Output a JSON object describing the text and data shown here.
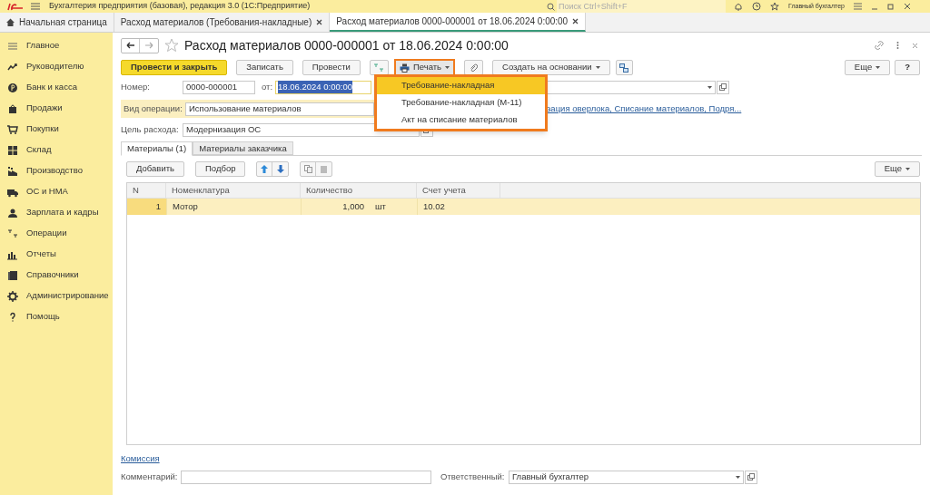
{
  "app_bar": {
    "title": "Бухгалтерия предприятия (базовая), редакция 3.0  (1С:Предприятие)",
    "search_placeholder": "Поиск Ctrl+Shift+F",
    "user": "Главный бухгалтер"
  },
  "tabs": [
    {
      "label": "Начальная страница",
      "kind": "home",
      "selected": false
    },
    {
      "label": "Расход материалов (Требования-накладные)",
      "kind": "doc",
      "selected": false
    },
    {
      "label": "Расход материалов 0000-000001 от 18.06.2024 0:00:00",
      "kind": "doc",
      "selected": true
    }
  ],
  "sidebar": {
    "items": [
      {
        "label": "Главное"
      },
      {
        "label": "Руководителю"
      },
      {
        "label": "Банк и касса"
      },
      {
        "label": "Продажи"
      },
      {
        "label": "Покупки"
      },
      {
        "label": "Склад"
      },
      {
        "label": "Производство"
      },
      {
        "label": "ОС и НМА"
      },
      {
        "label": "Зарплата и кадры"
      },
      {
        "label": "Операции"
      },
      {
        "label": "Отчеты"
      },
      {
        "label": "Справочники"
      },
      {
        "label": "Администрирование"
      },
      {
        "label": "Помощь"
      }
    ]
  },
  "form": {
    "title": "Расход материалов 0000-000001 от 18.06.2024 0:00:00",
    "toolbar": {
      "primary": "Провести и закрыть",
      "save": "Записать",
      "post": "Провести",
      "print": "Печать",
      "create_based": "Создать на основании",
      "more": "Еще",
      "help": "?"
    },
    "print_menu": [
      {
        "label": "Требование-накладная",
        "selected": true
      },
      {
        "label": "Требование-накладная (М-11)",
        "selected": false
      },
      {
        "label": "Акт на списание материалов",
        "selected": false
      }
    ],
    "number_label": "Номер:",
    "number": "0000-000001",
    "date_label": "от:",
    "date": "18.06.2024  0:00:00",
    "operation_label": "Вид операции:",
    "operation": "Использование материалов",
    "operation_link": "зация оверлока, Списание материалов, Подря...",
    "purpose_label": "Цель расхода:",
    "purpose": "Модернизация ОС",
    "sub_tabs": [
      {
        "label": "Материалы (1)",
        "selected": true
      },
      {
        "label": "Материалы заказчика",
        "selected": false
      }
    ],
    "table_toolbar": {
      "add": "Добавить",
      "pick": "Подбор",
      "more": "Еще"
    },
    "table": {
      "columns": [
        "N",
        "Номенклатура",
        "Количество",
        "Счет учета"
      ],
      "rows": [
        {
          "n": "1",
          "item": "Мотор",
          "qty": "1,000",
          "unit": "шт",
          "account": "10.02",
          "selected": true
        }
      ]
    },
    "commission_link": "Комиссия",
    "comment_label": "Комментарий:",
    "responsible_label": "Ответственный:",
    "responsible": "Главный бухгалтер"
  }
}
